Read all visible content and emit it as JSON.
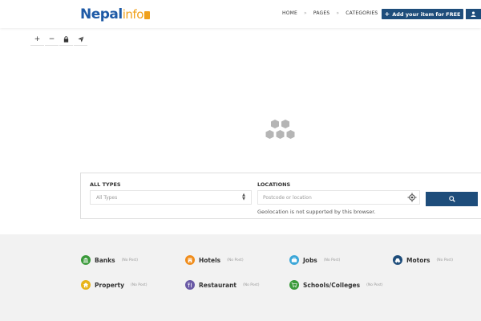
{
  "header": {
    "logo": {
      "nepal": "Nepal",
      "info": "info"
    },
    "nav": [
      {
        "label": "HOME"
      },
      {
        "label": "PAGES"
      },
      {
        "label": "CATEGORIES"
      }
    ],
    "nav_separator": "»",
    "add_button": {
      "icon": "plus-icon",
      "label": "Add your item for FREE"
    },
    "user_icon": "user-icon"
  },
  "map_controls": [
    {
      "label": "+",
      "icon": "zoom-in-icon"
    },
    {
      "label": "−",
      "icon": "zoom-out-icon"
    },
    {
      "icon": "lock-icon"
    },
    {
      "icon": "send-icon"
    }
  ],
  "search": {
    "types_label": "ALL TYPES",
    "types_value": "All Types",
    "locations_label": "LOCATIONS",
    "locations_placeholder": "Postcode or location",
    "geolocation_message": "Geolocation is not supported by this browser.",
    "search_icon": "search-icon"
  },
  "categories": [
    {
      "name": "Banks",
      "count": "(No Post)",
      "color": "#3a9a3a",
      "icon": "bank-icon"
    },
    {
      "name": "Hotels",
      "count": "(No Post)",
      "color": "#f08c1a",
      "icon": "hotel-icon"
    },
    {
      "name": "Jobs",
      "count": "(No Post)",
      "color": "#3aa6d8",
      "icon": "briefcase-icon"
    },
    {
      "name": "Motors",
      "count": "(No Post)",
      "color": "#1e4d7b",
      "icon": "car-icon"
    },
    {
      "name": "Property",
      "count": "(No Post)",
      "color": "#e8b41a",
      "icon": "home-icon"
    },
    {
      "name": "Restaurant",
      "count": "(No Post)",
      "color": "#6a5aa6",
      "icon": "restaurant-icon"
    },
    {
      "name": "Schools/Colleges",
      "count": "(No Post)",
      "color": "#3a9a3a",
      "icon": "cart-icon"
    }
  ],
  "colors": {
    "primary": "#1e4d7b",
    "logo_blue": "#1e5aa6",
    "logo_orange": "#f0a11c"
  }
}
